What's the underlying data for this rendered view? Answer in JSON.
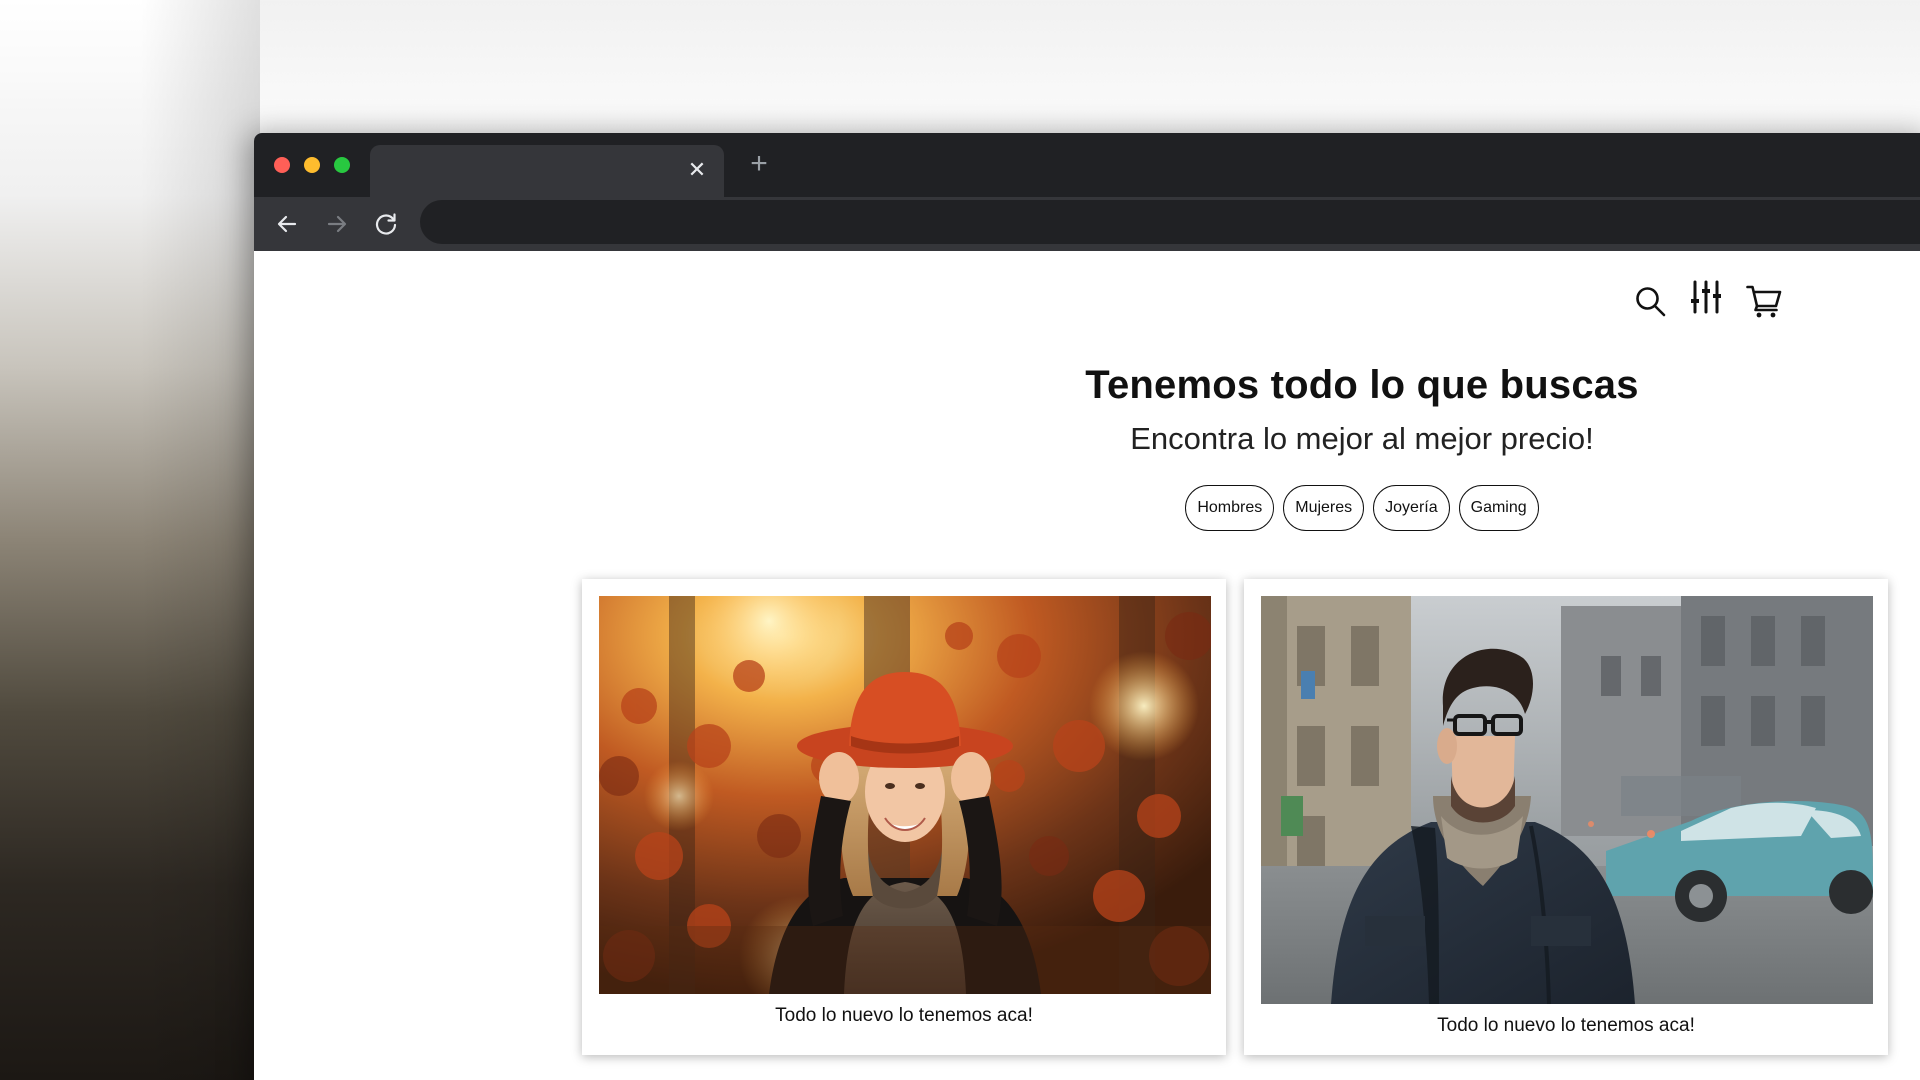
{
  "browser": {
    "tab": {
      "title": "",
      "close_icon": "close-icon"
    },
    "new_tab_icon": "plus-icon",
    "navigation": {
      "back_icon": "arrow-left-icon",
      "forward_icon": "arrow-right-icon",
      "reload_icon": "reload-icon"
    },
    "address_bar": {
      "value": ""
    }
  },
  "header": {
    "icons": [
      "search-icon",
      "sliders-icon",
      "cart-icon"
    ]
  },
  "hero": {
    "title": "Tenemos todo lo que buscas",
    "subtitle": "Encontra lo mejor al mejor precio!"
  },
  "categories": [
    {
      "label": "Hombres"
    },
    {
      "label": "Mujeres"
    },
    {
      "label": "Joyería"
    },
    {
      "label": "Gaming"
    }
  ],
  "cards": [
    {
      "image": "woman-autumn-photo",
      "caption": "Todo lo nuevo lo tenemos aca!"
    },
    {
      "image": "man-street-photo",
      "caption": "Todo lo nuevo lo tenemos aca!"
    }
  ],
  "colors": {
    "window_dark": "#202124",
    "toolbar": "#35363a",
    "close_red": "#ff5f57",
    "minimize_yellow": "#febc2e",
    "zoom_green": "#28c840"
  }
}
